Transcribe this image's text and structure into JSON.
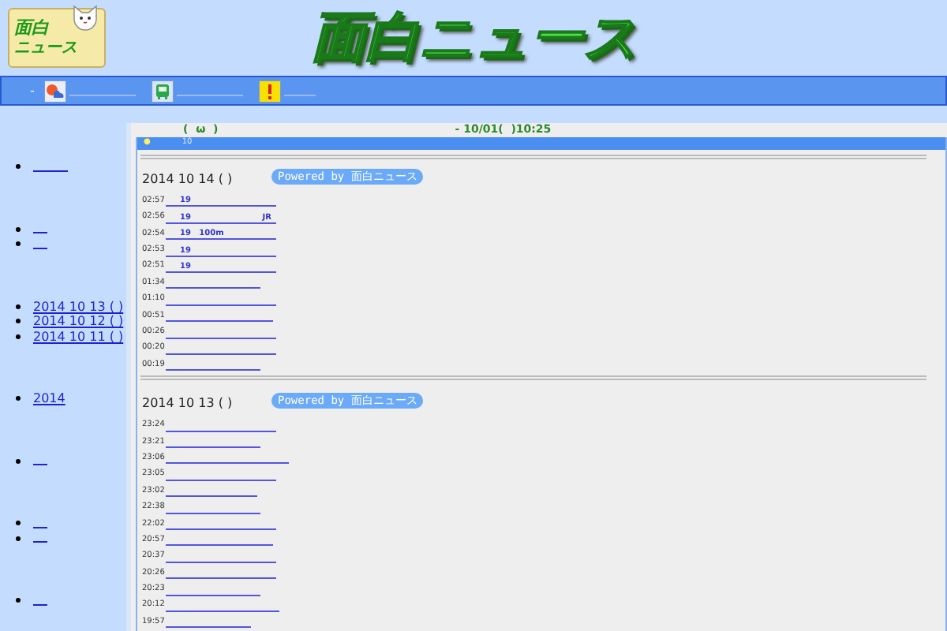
{
  "logo": {
    "line_1": "面白",
    "line_2": "ニュース"
  },
  "site_title": "面白ニュース",
  "nav": {
    "arrow": "-",
    "items": [
      {
        "kind": "weather"
      },
      {
        "kind": "train"
      },
      {
        "kind": "alert"
      }
    ]
  },
  "sidebar": {
    "groups": [
      {
        "items": [
          {
            "kind": "blank"
          }
        ]
      },
      {
        "items": [
          {
            "kind": "blank"
          },
          {
            "kind": "blank"
          }
        ]
      },
      {
        "items": [
          {
            "kind": "text",
            "text": "2014 10 13 ( )"
          },
          {
            "kind": "text",
            "text": "2014 10 12 ( )"
          },
          {
            "kind": "text",
            "text": "2014 10 11 ( )"
          }
        ]
      },
      {
        "items": [
          {
            "kind": "text",
            "text": "2014"
          }
        ]
      },
      {
        "items": [
          {
            "kind": "blank"
          }
        ]
      },
      {
        "items": [
          {
            "kind": "blank"
          },
          {
            "kind": "blank"
          }
        ]
      },
      {
        "items": [
          {
            "kind": "blank"
          }
        ]
      }
    ]
  },
  "top_line": {
    "left": "(  ω  )",
    "right": "- 10/01(  )10:25"
  },
  "blue_bar": {
    "bullet": "●",
    "text": "10"
  },
  "powered_by": [
    "Powered by 面白ニュース",
    "Powered by 面白ニュース"
  ],
  "sections": [
    {
      "date": "2014 10 14 ( )",
      "entries": [
        {
          "time": "02:57",
          "text": "19"
        },
        {
          "time": "02:56",
          "text": "19",
          "suffix": "JR"
        },
        {
          "time": "02:54",
          "text": "19   100m"
        },
        {
          "time": "02:53",
          "text": "19"
        },
        {
          "time": "02:51",
          "text": "19"
        },
        {
          "time": "01:34"
        },
        {
          "time": "01:10"
        },
        {
          "time": "00:51"
        },
        {
          "time": "00:26"
        },
        {
          "time": "00:20"
        },
        {
          "time": "00:19"
        }
      ]
    },
    {
      "date": "2014 10 13 ( )",
      "entries": [
        {
          "time": "23:24"
        },
        {
          "time": "23:21"
        },
        {
          "time": "23:06"
        },
        {
          "time": "23:05"
        },
        {
          "time": "23:02"
        },
        {
          "time": "22:38"
        },
        {
          "time": "22:02"
        },
        {
          "time": "20:57"
        },
        {
          "time": "20:37"
        },
        {
          "time": "20:26"
        },
        {
          "time": "20:23"
        },
        {
          "time": "20:12"
        },
        {
          "time": "19:57"
        }
      ]
    }
  ]
}
